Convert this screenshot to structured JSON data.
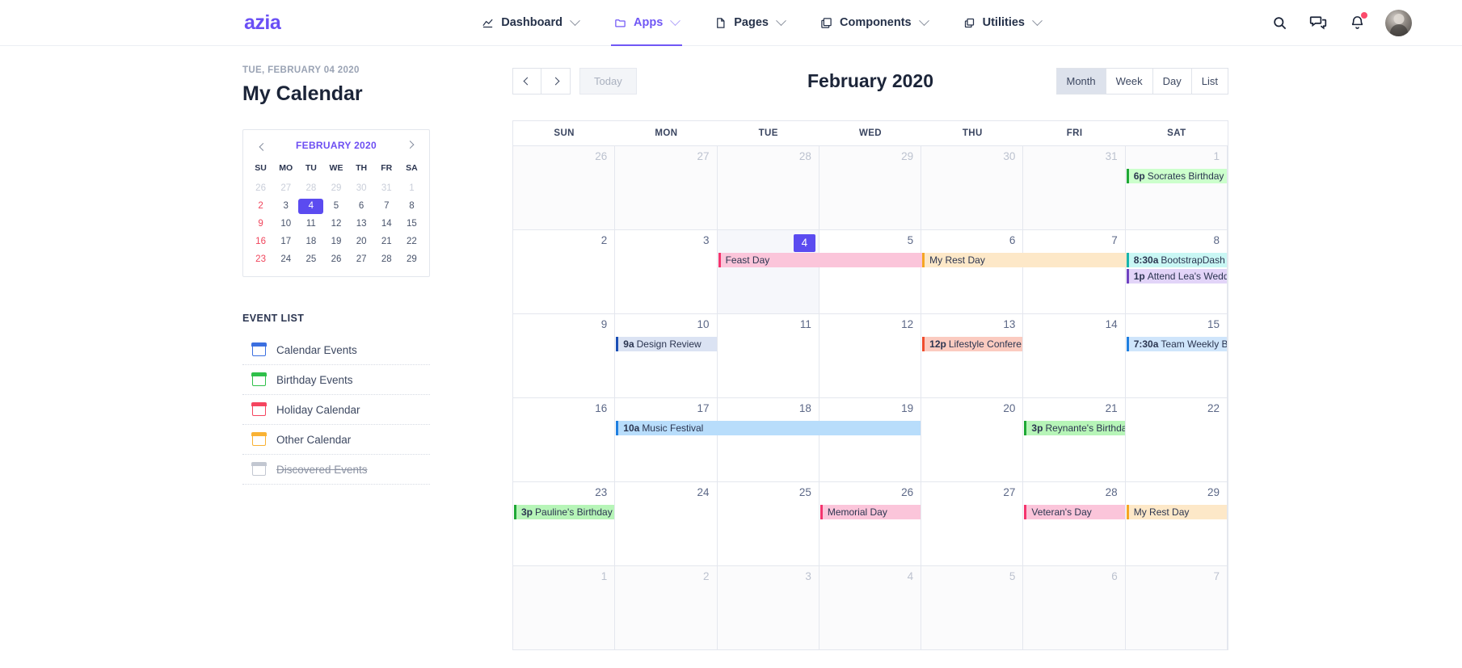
{
  "brand": "azia",
  "nav": {
    "items": [
      {
        "label": "Dashboard",
        "icon": "chart-icon",
        "active": false
      },
      {
        "label": "Apps",
        "icon": "folder-icon",
        "active": true
      },
      {
        "label": "Pages",
        "icon": "file-icon",
        "active": false
      },
      {
        "label": "Components",
        "icon": "layers-icon",
        "active": false
      },
      {
        "label": "Utilities",
        "icon": "copy-icon",
        "active": false
      }
    ],
    "right": [
      {
        "name": "search-icon"
      },
      {
        "name": "chat-icon"
      },
      {
        "name": "bell-icon",
        "badge": true
      },
      {
        "name": "avatar"
      }
    ]
  },
  "sidebar": {
    "date_label": "TUE, FEBRUARY 04 2020",
    "title": "My Calendar",
    "mini_calendar": {
      "title": "FEBRUARY 2020",
      "prev_label": "‹",
      "next_label": "›",
      "dow": [
        "SU",
        "MO",
        "TU",
        "WE",
        "TH",
        "FR",
        "SA"
      ],
      "weeks": [
        [
          {
            "d": "26",
            "mute": true
          },
          {
            "d": "27",
            "mute": true
          },
          {
            "d": "28",
            "mute": true
          },
          {
            "d": "29",
            "mute": true
          },
          {
            "d": "30",
            "mute": true
          },
          {
            "d": "31",
            "mute": true
          },
          {
            "d": "1",
            "mute": true
          }
        ],
        [
          {
            "d": "2",
            "sun": true
          },
          {
            "d": "3"
          },
          {
            "d": "4",
            "sel": true
          },
          {
            "d": "5"
          },
          {
            "d": "6"
          },
          {
            "d": "7"
          },
          {
            "d": "8"
          }
        ],
        [
          {
            "d": "9",
            "sun": true
          },
          {
            "d": "10"
          },
          {
            "d": "11"
          },
          {
            "d": "12"
          },
          {
            "d": "13"
          },
          {
            "d": "14"
          },
          {
            "d": "15"
          }
        ],
        [
          {
            "d": "16",
            "sun": true
          },
          {
            "d": "17"
          },
          {
            "d": "18"
          },
          {
            "d": "19"
          },
          {
            "d": "20"
          },
          {
            "d": "21"
          },
          {
            "d": "22"
          }
        ],
        [
          {
            "d": "23",
            "sun": true
          },
          {
            "d": "24"
          },
          {
            "d": "25"
          },
          {
            "d": "26"
          },
          {
            "d": "27"
          },
          {
            "d": "28"
          },
          {
            "d": "29"
          }
        ]
      ]
    },
    "event_list_title": "EVENT LIST",
    "event_list": [
      {
        "label": "Calendar Events",
        "color": "#3b6fe0",
        "done": false
      },
      {
        "label": "Birthday Events",
        "color": "#2fc04a",
        "done": false
      },
      {
        "label": "Holiday Calendar",
        "color": "#f5455f",
        "done": false
      },
      {
        "label": "Other Calendar",
        "color": "#f9b234",
        "done": false
      },
      {
        "label": "Discovered Events",
        "color": "#9aa3b4",
        "done": true
      }
    ]
  },
  "calendar": {
    "title": "February 2020",
    "prev_label": "‹",
    "next_label": "›",
    "today_label": "Today",
    "views": [
      {
        "label": "Month",
        "active": true
      },
      {
        "label": "Week",
        "active": false
      },
      {
        "label": "Day",
        "active": false
      },
      {
        "label": "List",
        "active": false
      }
    ],
    "dow": [
      "SUN",
      "MON",
      "TUE",
      "WED",
      "THU",
      "FRI",
      "SAT"
    ],
    "weeks": [
      {
        "days": [
          {
            "n": "26",
            "other": true
          },
          {
            "n": "27",
            "other": true
          },
          {
            "n": "28",
            "other": true
          },
          {
            "n": "29",
            "other": true
          },
          {
            "n": "30",
            "other": true
          },
          {
            "n": "31",
            "other": true
          },
          {
            "n": "1",
            "other": true
          }
        ],
        "events": [
          {
            "time": "6p",
            "title": "Socrates Birthday",
            "start": 6,
            "span": 1,
            "row": 0,
            "bg": "#ccffcc",
            "border": "#1fa836"
          }
        ]
      },
      {
        "days": [
          {
            "n": "2"
          },
          {
            "n": "3"
          },
          {
            "n": "4",
            "selected": true,
            "today": true
          },
          {
            "n": "5"
          },
          {
            "n": "6"
          },
          {
            "n": "7"
          },
          {
            "n": "8"
          }
        ],
        "events": [
          {
            "time": "",
            "title": "Feast Day",
            "start": 2,
            "span": 3,
            "row": 0,
            "bg": "#fbc5da",
            "border": "#f4356e"
          },
          {
            "time": "",
            "title": "My Rest Day",
            "start": 4,
            "span": 3,
            "row": 0,
            "bg": "#fde8c8",
            "border": "#f5a623"
          },
          {
            "time": "8:30a",
            "title": "BootstrapDash",
            "start": 6,
            "span": 1,
            "row": 0,
            "bg": "#c9f7f4",
            "border": "#17b5ad"
          },
          {
            "time": "1p",
            "title": "Attend Lea's Wedd",
            "start": 6,
            "span": 1,
            "row": 1,
            "bg": "#e2d4f8",
            "border": "#6f42c1"
          }
        ]
      },
      {
        "days": [
          {
            "n": "9"
          },
          {
            "n": "10"
          },
          {
            "n": "11"
          },
          {
            "n": "12"
          },
          {
            "n": "13"
          },
          {
            "n": "14"
          },
          {
            "n": "15"
          }
        ],
        "events": [
          {
            "time": "9a",
            "title": "Design Review",
            "start": 1,
            "span": 1,
            "row": 0,
            "bg": "#dbe3f3",
            "border": "#1b4fb5"
          },
          {
            "time": "12p",
            "title": "Lifestyle Confere",
            "start": 4,
            "span": 1,
            "row": 0,
            "bg": "#fbcbc0",
            "border": "#ef4d2e"
          },
          {
            "time": "7:30a",
            "title": "Team Weekly B",
            "start": 6,
            "span": 1,
            "row": 0,
            "bg": "#cfe5fb",
            "border": "#1f7fe0"
          }
        ]
      },
      {
        "days": [
          {
            "n": "16"
          },
          {
            "n": "17"
          },
          {
            "n": "18"
          },
          {
            "n": "19"
          },
          {
            "n": "20"
          },
          {
            "n": "21"
          },
          {
            "n": "22"
          }
        ],
        "events": [
          {
            "time": "10a",
            "title": "Music Festival",
            "start": 1,
            "span": 3,
            "row": 0,
            "bg": "#b8ddfb",
            "border": "#1f7fe0"
          },
          {
            "time": "3p",
            "title": "Reynante's Birthda",
            "start": 5,
            "span": 1,
            "row": 0,
            "bg": "#b7f5b8",
            "border": "#1fa836"
          }
        ]
      },
      {
        "days": [
          {
            "n": "23"
          },
          {
            "n": "24"
          },
          {
            "n": "25"
          },
          {
            "n": "26"
          },
          {
            "n": "27"
          },
          {
            "n": "28"
          },
          {
            "n": "29"
          }
        ],
        "events": [
          {
            "time": "3p",
            "title": "Pauline's Birthday",
            "start": 0,
            "span": 1,
            "row": 0,
            "bg": "#b7f5b8",
            "border": "#1fa836"
          },
          {
            "time": "",
            "title": "Memorial Day",
            "start": 3,
            "span": 1,
            "row": 0,
            "bg": "#fbc5da",
            "border": "#f4356e"
          },
          {
            "time": "",
            "title": "Veteran's Day",
            "start": 5,
            "span": 1,
            "row": 0,
            "bg": "#fbc5da",
            "border": "#f4356e"
          },
          {
            "time": "",
            "title": "My Rest Day",
            "start": 6,
            "span": 1,
            "row": 0,
            "bg": "#fde8c8",
            "border": "#f5a623"
          }
        ]
      },
      {
        "days": [
          {
            "n": "1",
            "other": true
          },
          {
            "n": "2",
            "other": true
          },
          {
            "n": "3",
            "other": true
          },
          {
            "n": "4",
            "other": true
          },
          {
            "n": "5",
            "other": true
          },
          {
            "n": "6",
            "other": true
          },
          {
            "n": "7",
            "other": true
          }
        ],
        "events": []
      }
    ]
  }
}
